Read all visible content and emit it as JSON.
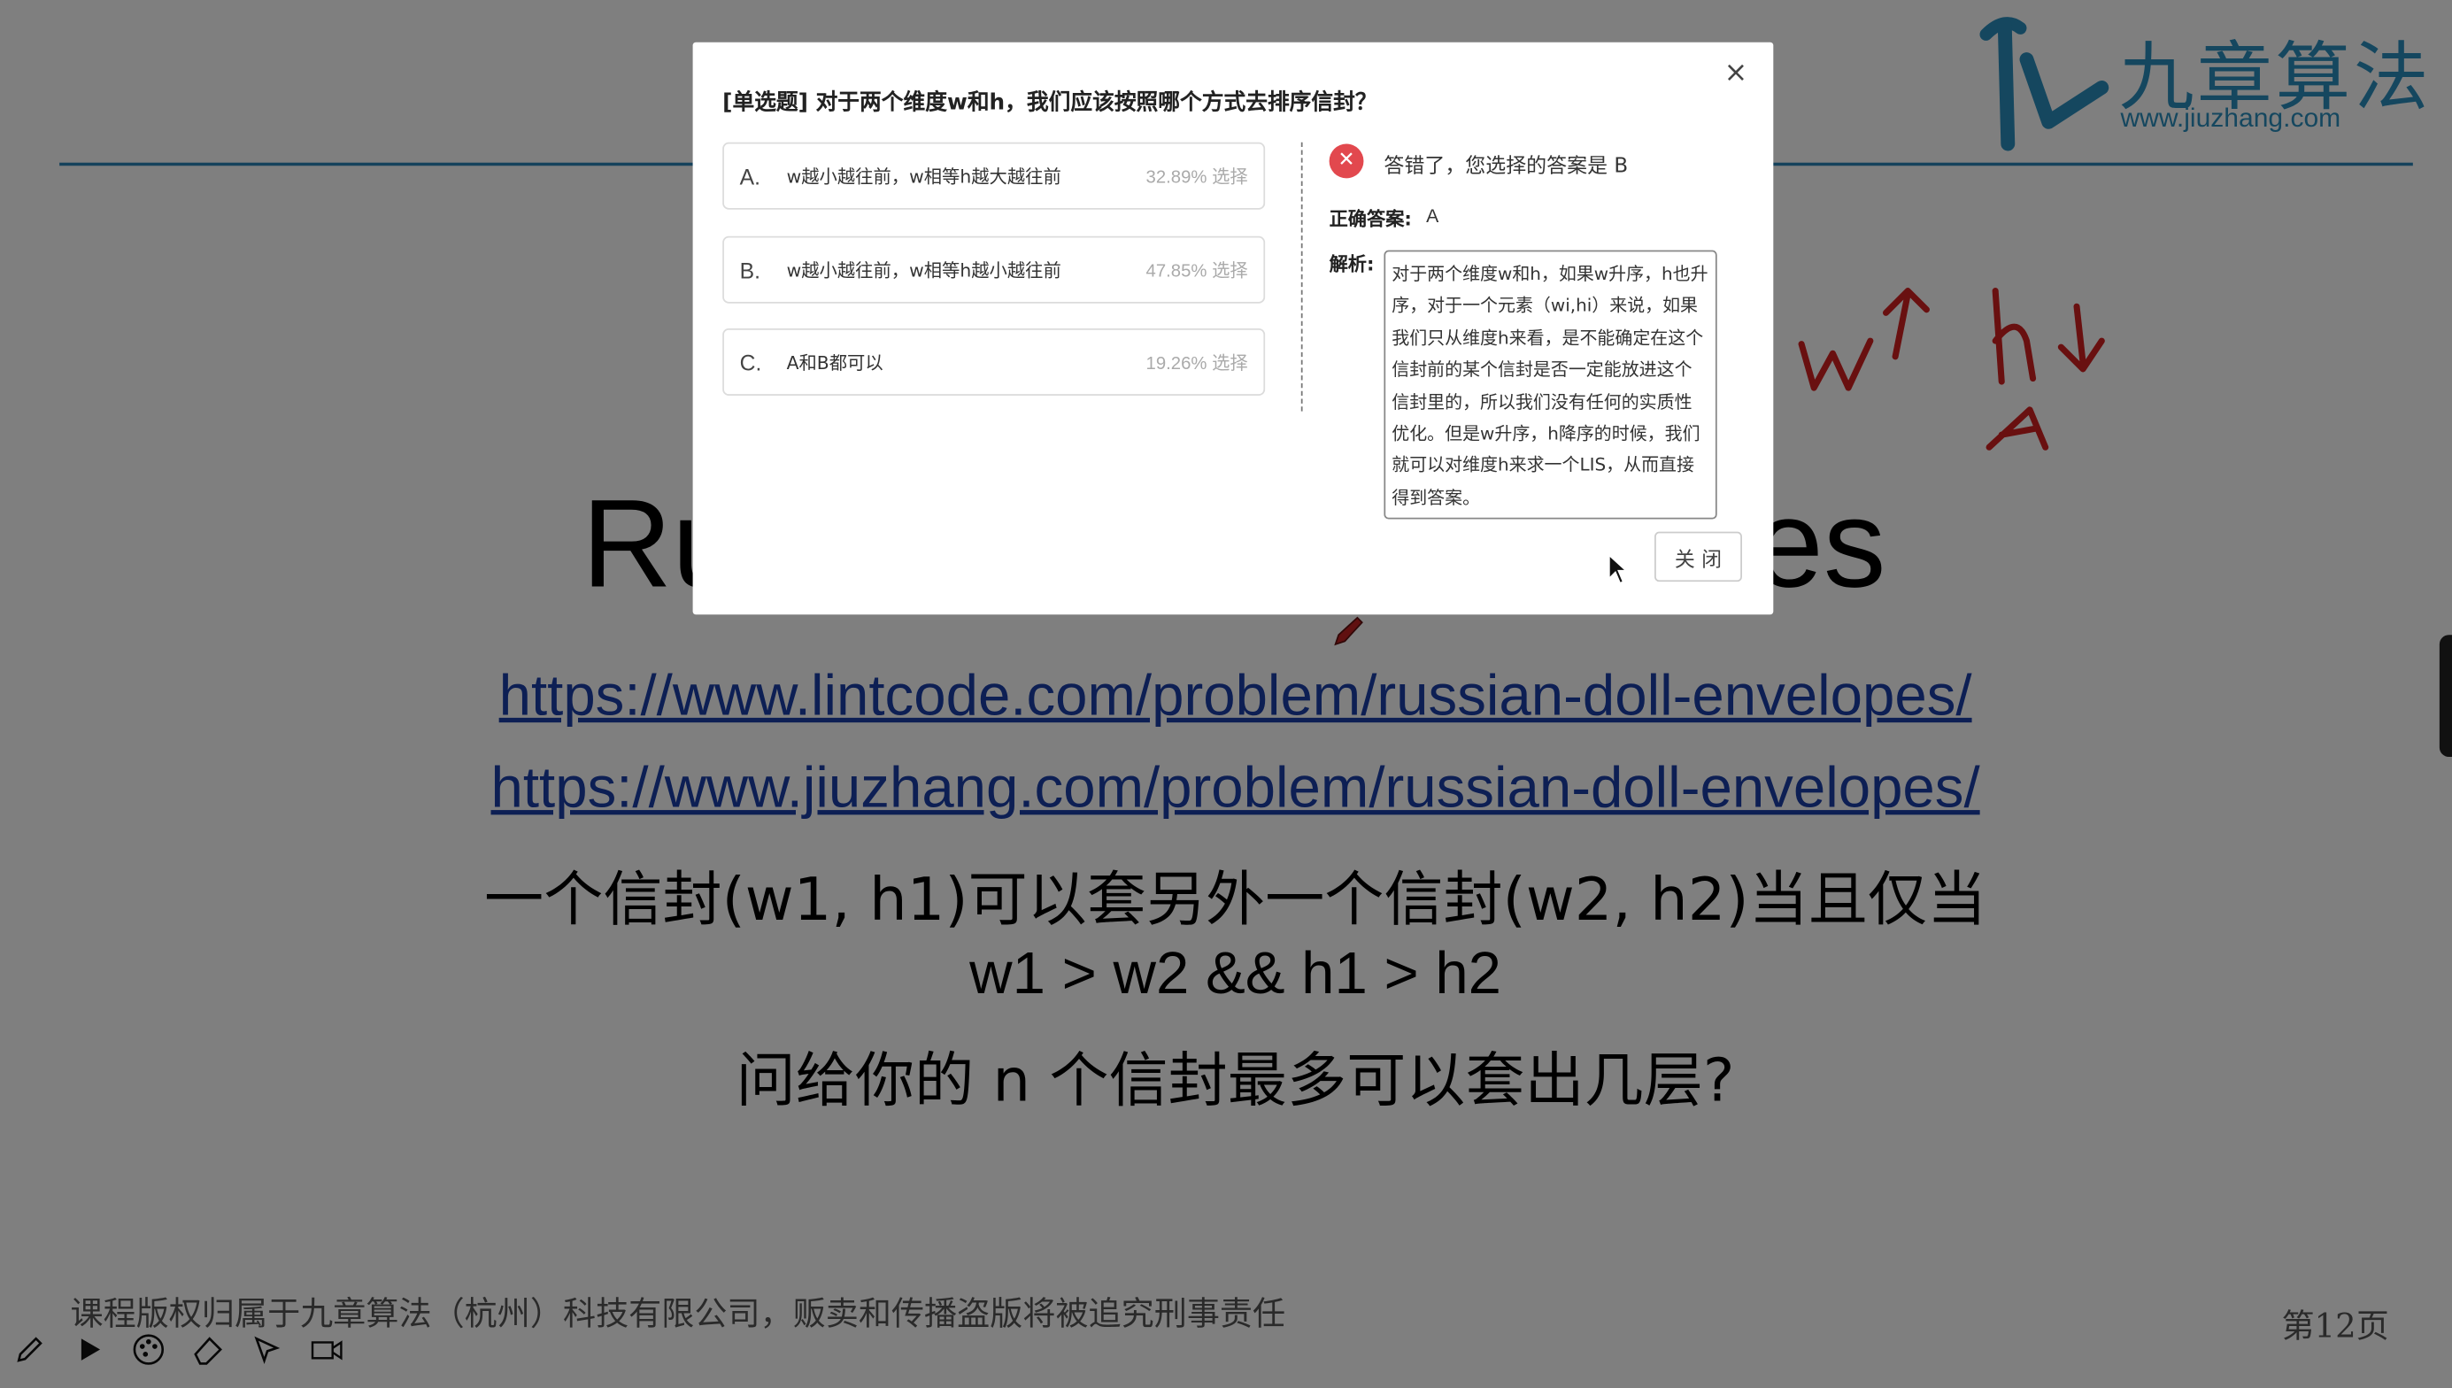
{
  "logo": {
    "name": "九章算法",
    "url": "www.jiuzhang.com"
  },
  "slide": {
    "title_left": "Ru",
    "title_right": "es",
    "links": [
      "https://www.lintcode.com/problem/russian-doll-envelopes/",
      "https://www.jiuzhang.com/problem/russian-doll-envelopes/"
    ],
    "lines": [
      "一个信封(w1, h1)可以套另外一个信封(w2, h2)当且仅当",
      "w1 > w2 && h1 > h2",
      "问给你的 n 个信封最多可以套出几层?"
    ],
    "footer": "课程版权归属于九章算法（杭州）科技有限公司，贩卖和传播盗版将被追究刑事责任",
    "page": "第12页"
  },
  "toolbar_icons": [
    "pen-icon",
    "play-icon",
    "palette-icon",
    "eraser-icon",
    "pointer-icon",
    "video-camera-icon"
  ],
  "dialog": {
    "close_glyph": "×",
    "question": "[单选题]  对于两个维度w和h，我们应该按照哪个方式去排序信封？",
    "options": [
      {
        "letter": "A.",
        "text": "w越小越往前，w相等h越大越往前",
        "pct": "32.89% 选择"
      },
      {
        "letter": "B.",
        "text": "w越小越往前，w相等h越小越往前",
        "pct": "47.85% 选择"
      },
      {
        "letter": "C.",
        "text": "A和B都可以",
        "pct": "19.26% 选择"
      }
    ],
    "result_message": "答错了，您选择的答案是 B",
    "correct_label": "正确答案:",
    "correct_value": "A",
    "analysis_label": "解析:",
    "analysis_text": "对于两个维度w和h，如果w升序，h也升序，对于一个元素（wi,hi）来说，如果我们只从维度h来看，是不能确定在这个信封前的某个信封是否一定能放进这个信封里的，所以我们没有任何的实质性优化。但是w升序，h降序的时候，我们就可以对维度h来求一个LIS，从而直接得到答案。",
    "close_button": "关 闭"
  },
  "colors": {
    "accent": "#2a8fbe",
    "link": "#1a3fa8",
    "wrong": "#e2484e",
    "annotation": "#d22020"
  }
}
